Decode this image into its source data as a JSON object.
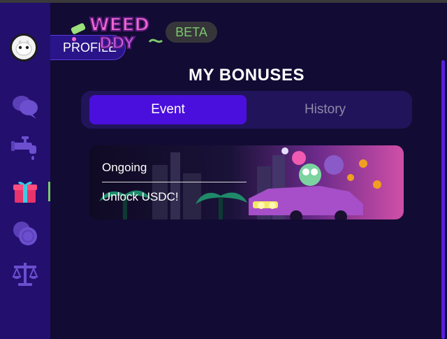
{
  "app": {
    "logo_text": "WEED DADDY",
    "beta_label": "BETA"
  },
  "sidebar": {
    "profile_label": "PROFILE",
    "items": [
      {
        "icon": "chat-icon",
        "active": false
      },
      {
        "icon": "faucet-icon",
        "active": false
      },
      {
        "icon": "gift-icon",
        "active": true
      },
      {
        "icon": "coins-icon",
        "active": false
      },
      {
        "icon": "scales-icon",
        "active": false
      }
    ]
  },
  "page": {
    "title": "MY BONUSES"
  },
  "tabs": [
    {
      "label": "Event",
      "active": true
    },
    {
      "label": "History",
      "active": false
    }
  ],
  "bonus_card": {
    "status": "Ongoing",
    "title": "Unlock USDC!"
  },
  "colors": {
    "accent": "#4a0fdc",
    "sidebar_bg": "#230f6e",
    "page_bg": "#120b33",
    "beta_text": "#7cc86e",
    "active_marker": "#7cc86e"
  }
}
